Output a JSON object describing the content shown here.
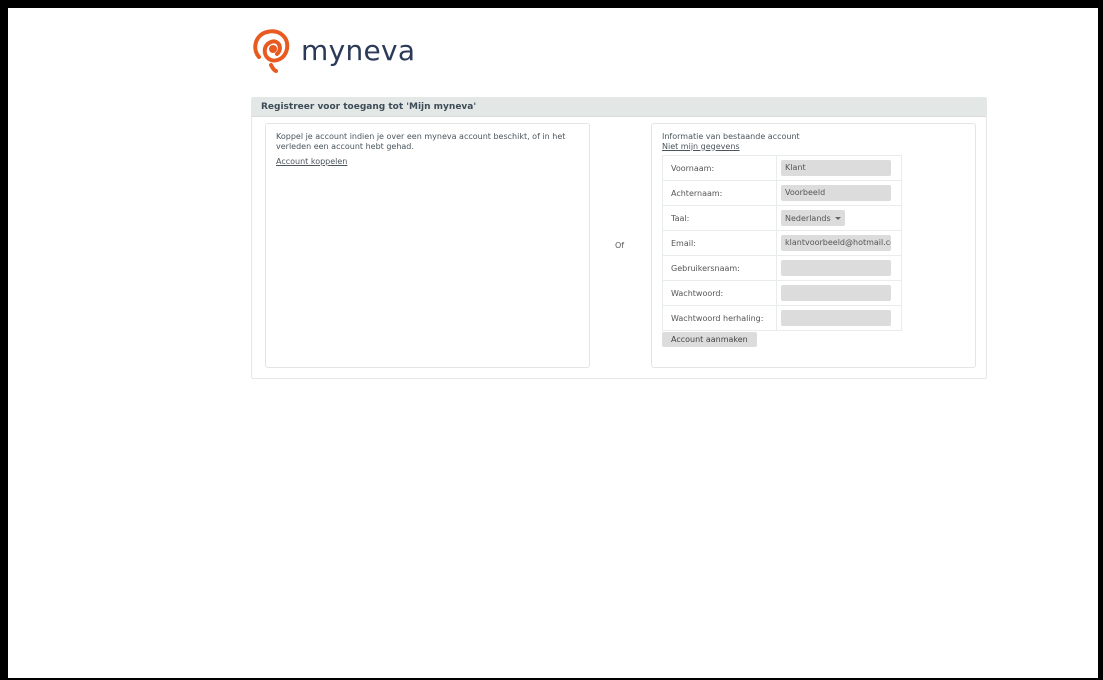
{
  "brand": {
    "name": "myneva",
    "accent": "#e85a20",
    "text_color": "#2c3a5a"
  },
  "panel": {
    "title": "Registreer voor toegang tot 'Mijn myneva'",
    "left": {
      "intro": "Koppel je account indien je over een myneva account beschikt, of in het verleden een account hebt gehad.",
      "link": "Account koppelen"
    },
    "separator": "Of",
    "right": {
      "title": "Informatie van bestaande account",
      "link": "Niet mijn gegevens",
      "fields": {
        "first_name": {
          "label": "Voornaam:",
          "value": "Klant"
        },
        "last_name": {
          "label": "Achternaam:",
          "value": "Voorbeeld"
        },
        "language": {
          "label": "Taal:",
          "value": "Nederlands"
        },
        "email": {
          "label": "Email:",
          "value": "klantvoorbeeld@hotmail.cc"
        },
        "username": {
          "label": "Gebruikersnaam:",
          "value": ""
        },
        "password": {
          "label": "Wachtwoord:",
          "value": ""
        },
        "password_repeat": {
          "label": "Wachtwoord herhaling:",
          "value": ""
        }
      },
      "submit": "Account aanmaken"
    }
  }
}
